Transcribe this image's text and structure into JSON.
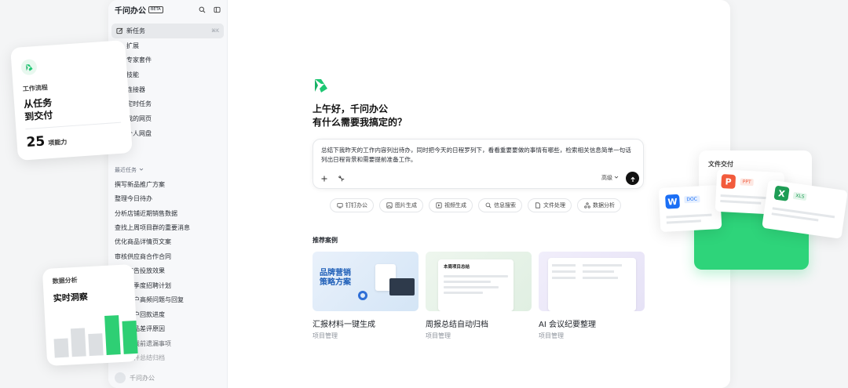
{
  "sidebar": {
    "app_title": "千问办公",
    "beta": "BETA",
    "nav": [
      {
        "label": "新任务",
        "shortcut": "⌘K",
        "icon": "edit-icon"
      },
      {
        "label": "扩展",
        "icon": "extension-icon"
      },
      {
        "label": "专家套件",
        "icon": "expert-icon"
      },
      {
        "label": "技能",
        "icon": "skill-icon"
      },
      {
        "label": "连接器",
        "icon": "connector-icon"
      },
      {
        "label": "定时任务",
        "icon": "clock-icon"
      },
      {
        "label": "我的网页",
        "icon": "web-icon"
      },
      {
        "label": "个人网盘",
        "icon": "cloud-icon"
      }
    ],
    "more": "...",
    "recent_title": "最近任务",
    "recent": [
      "撰写新品推广方案",
      "整理今日待办",
      "分析店铺近期销售数据",
      "查找上周项目群的重要消息",
      "优化商品详情页文案",
      "审核供应商合作合同",
      "评估广告投放效果",
      "制定下季度招聘计划",
      "汇总客户高频问题与回复",
      "跟进客户回款进度",
      "分析商品差评原因",
      "梳理上线前遗漏事项",
      "整理文件总结归档"
    ],
    "footer_user": "千问办公"
  },
  "main": {
    "greeting_line1": "上午好，千问办公",
    "greeting_line2": "有什么需要我搞定的？",
    "prompt_text": "总结下我昨天的工作内容列出待办，同时把今天的日程罗列下，看看重要要做的事情有哪些，检索相关信息简单一句话列出日程背景和需要提前准备工作。",
    "advanced_label": "高级",
    "chips": [
      {
        "label": "钉钉办公",
        "icon": "dingtalk-icon"
      },
      {
        "label": "图片生成",
        "icon": "image-icon"
      },
      {
        "label": "视频生成",
        "icon": "video-icon"
      },
      {
        "label": "信息搜索",
        "icon": "search-icon"
      },
      {
        "label": "文件处理",
        "icon": "file-icon"
      },
      {
        "label": "数据分析",
        "icon": "data-icon"
      }
    ],
    "recommend_title": "推荐案例",
    "cards": [
      {
        "title": "汇报材料一键生成",
        "tag": "项目管理",
        "thumb_text_line1": "品牌营销",
        "thumb_text_line2": "策略方案"
      },
      {
        "title": "周报总结自动归档",
        "tag": "项目管理",
        "thumb_text": "本周项目总结"
      },
      {
        "title": "AI 会议纪要整理",
        "tag": "项目管理"
      }
    ]
  },
  "promo": {
    "workflow": {
      "label": "工作流程",
      "title_line1": "从任务",
      "title_line2": "到交付",
      "count": "25",
      "count_label": "项能力"
    },
    "analysis": {
      "label": "数据分析",
      "title": "实时洞察"
    },
    "delivery": {
      "label": "文件交付",
      "doc": "DOC",
      "ppt": "PPT",
      "xls": "XLS"
    }
  }
}
